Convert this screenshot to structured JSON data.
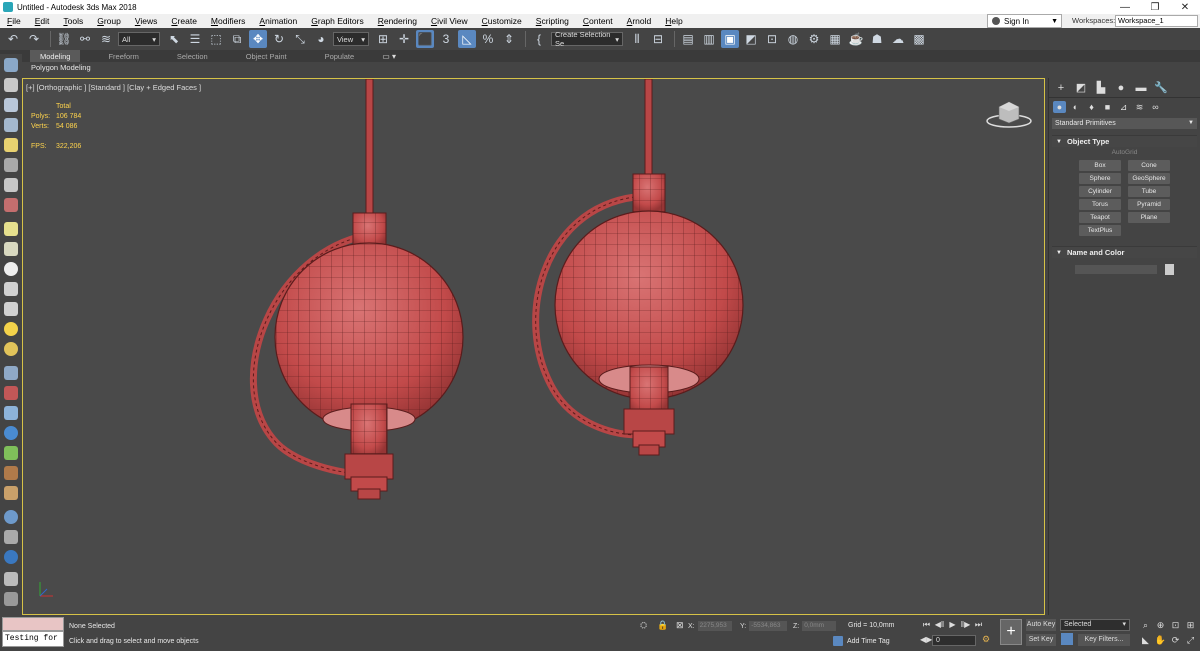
{
  "window": {
    "title": "Untitled - Autodesk 3ds Max 2018",
    "minimize": "—",
    "maximize": "❐",
    "close": "✕"
  },
  "menu": {
    "items": [
      "File",
      "Edit",
      "Tools",
      "Group",
      "Views",
      "Create",
      "Modifiers",
      "Animation",
      "Graph Editors",
      "Rendering",
      "Civil View",
      "Customize",
      "Scripting",
      "Content",
      "Arnold",
      "Help"
    ],
    "sign_in": "Sign In",
    "workspaces_label": "Workspaces:",
    "workspace_value": "Workspace_1"
  },
  "toolbar": {
    "selection_filter": "All",
    "reference_coord": "View",
    "named_selection": "Create Selection Se",
    "snap_value": "3",
    "angle_snap_value": "%"
  },
  "ribbon": {
    "tabs": [
      "Modeling",
      "Freeform",
      "Selection",
      "Object Paint",
      "Populate"
    ],
    "active_tab": "Modeling",
    "sub_label": "Polygon Modeling"
  },
  "viewport": {
    "label": "[+] [Orthographic ] [Standard ] [Clay + Edged Faces ]",
    "stats": {
      "header": "Total",
      "polys_label": "Polys:",
      "polys_value": "106 784",
      "verts_label": "Verts:",
      "verts_value": "54 086",
      "fps_label": "FPS:",
      "fps_value": "322,206"
    }
  },
  "command_panel": {
    "category": "Standard Primitives",
    "object_type_title": "Object Type",
    "autogrid": "AutoGrid",
    "objects": [
      "Box",
      "Cone",
      "Sphere",
      "GeoSphere",
      "Cylinder",
      "Tube",
      "Torus",
      "Pyramid",
      "Teapot",
      "Plane",
      "TextPlus"
    ],
    "name_color_title": "Name and Color"
  },
  "status": {
    "maxscript_value": "Testing for :",
    "selection": "None Selected",
    "prompt": "Click and drag to select and move objects",
    "x_label": "X:",
    "x_value": "2275,953",
    "y_label": "Y:",
    "y_value": "-5534,863",
    "z_label": "Z:",
    "z_value": "0,0mm",
    "grid": "Grid = 10,0mm",
    "add_time_tag": "Add Time Tag",
    "frame": "0",
    "auto_key": "Auto Key",
    "set_key": "Set Key",
    "key_mode": "Selected",
    "key_filters": "Key Filters..."
  },
  "colors": {
    "viewport_bg": "#4a4a4a",
    "viewport_border": "#d6c247",
    "model_fill": "#c24a4a",
    "wire": "#5a1c1c",
    "stats_text": "#ffd44d",
    "active_blue": "#5a88c0"
  }
}
